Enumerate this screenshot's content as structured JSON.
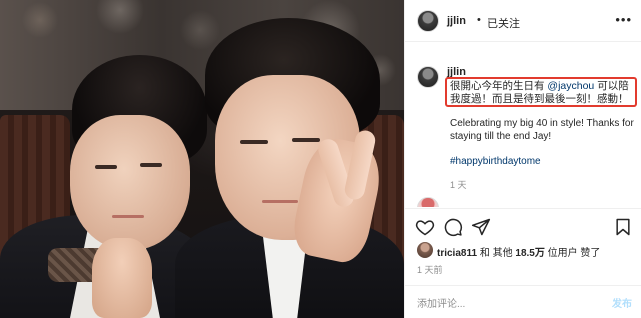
{
  "post": {
    "username": "jjlin",
    "dot": "•",
    "follow_status": "已关注",
    "more_icon": "more-horizontal-icon",
    "caption": {
      "username": "jjlin",
      "cn_part1": "很開心今年的生日有 ",
      "mention": "@jaychou",
      "cn_part2": " 可以陪我度過！而且是待到最後一刻！感動！",
      "en_text": "Celebrating my big 40 in style! Thanks for staying till the end Jay!",
      "hashtag": "#happybirthdaytome",
      "time": "1 天"
    },
    "actions": {
      "like_icon": "heart-icon",
      "comment_icon": "comment-icon",
      "share_icon": "paper-plane-icon",
      "save_icon": "bookmark-icon"
    },
    "likes": {
      "liker": "tricia811",
      "middle": "和 其他 ",
      "count": "18.5万",
      "suffix": " 位用户 赞了"
    },
    "time": "1 天前",
    "comment_placeholder": "添加评论...",
    "post_button": "发布"
  },
  "colors": {
    "highlight_box": "#e23b2e",
    "link": "#00376b",
    "muted": "#8e8e8e",
    "post_button_disabled": "#b2dffc"
  }
}
